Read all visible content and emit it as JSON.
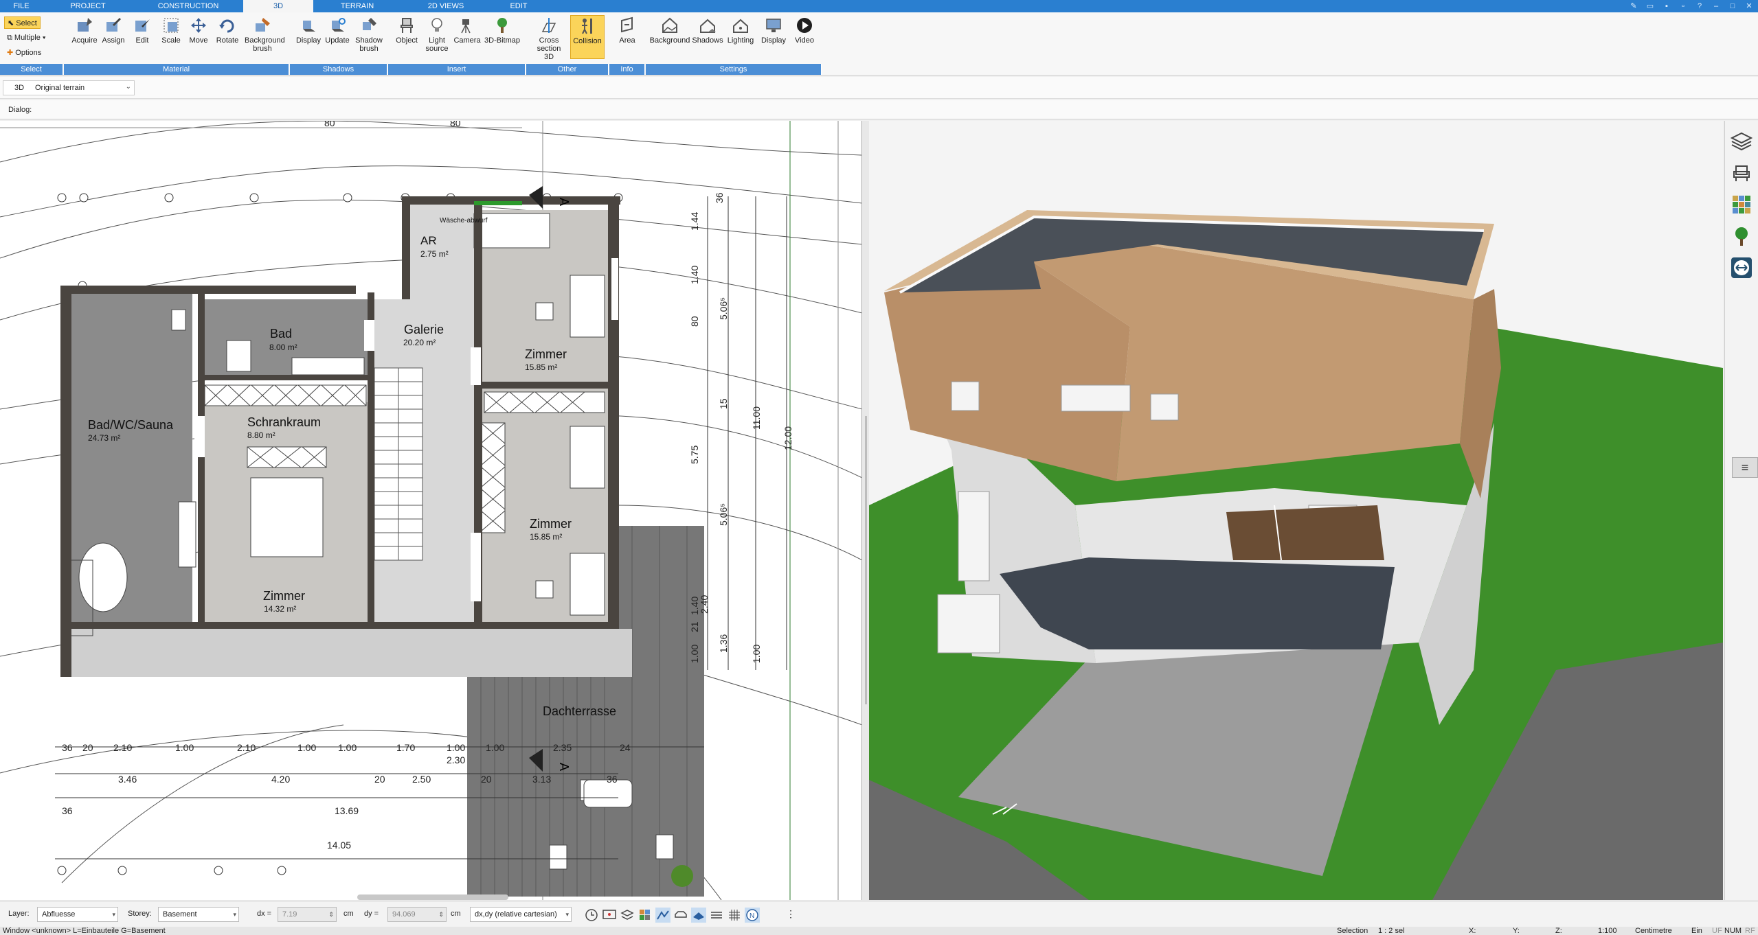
{
  "menu": {
    "tabs": [
      "FILE",
      "PROJECT",
      "CONSTRUCTION",
      "3D",
      "TERRAIN",
      "2D VIEWS",
      "EDIT"
    ],
    "active": "3D"
  },
  "ribbon": {
    "select_group": {
      "select": "Select",
      "multiple": "Multiple",
      "options": "Options",
      "label": "Select"
    },
    "material_group": {
      "label": "Material",
      "buttons": [
        "Acquire",
        "Assign",
        "Edit",
        "Scale",
        "Move",
        "Rotate",
        "Background brush"
      ]
    },
    "shadows_group": {
      "label": "Shadows",
      "buttons": [
        "Display",
        "Update",
        "Shadow brush"
      ]
    },
    "insert_group": {
      "label": "Insert",
      "buttons": [
        "Object",
        "Light source",
        "Camera",
        "3D-Bitmap"
      ]
    },
    "other_group": {
      "label": "Other",
      "buttons": [
        "Cross section 3D",
        "Collision"
      ]
    },
    "info_group": {
      "label": "Info",
      "buttons": [
        "Area"
      ]
    },
    "settings_group": {
      "label": "Settings",
      "buttons": [
        "Background",
        "Shadows",
        "Lighting",
        "Display",
        "Video"
      ]
    }
  },
  "viewbar": {
    "mode": "3D",
    "terrain": "Original terrain"
  },
  "dialog": {
    "label": "Dialog:"
  },
  "plan": {
    "rooms": [
      {
        "name": "AR",
        "area": "2.75 m²"
      },
      {
        "name": "Bad",
        "area": "8.00 m²"
      },
      {
        "name": "Galerie",
        "area": "20.20 m²"
      },
      {
        "name": "Zimmer",
        "area": "15.85 m²"
      },
      {
        "name": "Bad/WC/Sauna",
        "area": "24.73 m²"
      },
      {
        "name": "Schrankraum",
        "area": "8.80 m²"
      },
      {
        "name": "Zimmer",
        "area": "15.85 m²"
      },
      {
        "name": "Zimmer",
        "area": "14.32 m²"
      },
      {
        "name": "Dachterrasse",
        "area": ""
      }
    ],
    "note": "Wäsche-abwurf",
    "section_marker": "A",
    "top_dims": [
      "80",
      "80"
    ],
    "right_dims_a": [
      "36",
      "1.44",
      "1.40",
      "80",
      "15",
      "5.75",
      "5.06⁵",
      "1.40",
      "21",
      "1.00"
    ],
    "right_dims_b": [
      "5.06⁵",
      "11.00",
      "2.40",
      "1.36",
      "1.00"
    ],
    "right_dims_c": [
      "12.00"
    ],
    "bottom_row1": [
      "36",
      "20",
      "2.10",
      "1.00",
      "2.10",
      "1.00",
      "1.00",
      "1.70",
      "1.00",
      "1.00",
      "2.35",
      "24"
    ],
    "bottom_row2": [
      "3.46",
      "4.20",
      "20",
      "2.50",
      "20",
      "3.13",
      "36",
      "2.30"
    ],
    "bottom_row3": [
      "36",
      "13.69"
    ],
    "bottom_row4": [
      "14.05"
    ]
  },
  "status": {
    "layer_label": "Layer:",
    "layer": "Abfluesse",
    "storey_label": "Storey:",
    "storey": "Basement",
    "dx_label": "dx =",
    "dx": "7.19",
    "dx_unit": "cm",
    "dy_label": "dy =",
    "dy": "94.069",
    "dy_unit": "cm",
    "coord_mode": "dx,dy (relative cartesian)"
  },
  "bottom": {
    "window": "Window <unknown> L=Einbauteile G=Basement",
    "selection": "Selection",
    "scale_sel": "1 : 2 sel",
    "x": "X:",
    "y": "Y:",
    "z": "Z:",
    "scale": "1:100",
    "unit": "Centimetre",
    "ein": "Ein",
    "uf": "UF",
    "num": "NUM",
    "rf": "RF"
  },
  "colors": {
    "accent": "#2a7fd0",
    "group": "#4b8ed6",
    "active_button": "#fbd45a",
    "grass": "#3e8f2a",
    "roof": "#4a5058",
    "wood": "#b98f68"
  }
}
